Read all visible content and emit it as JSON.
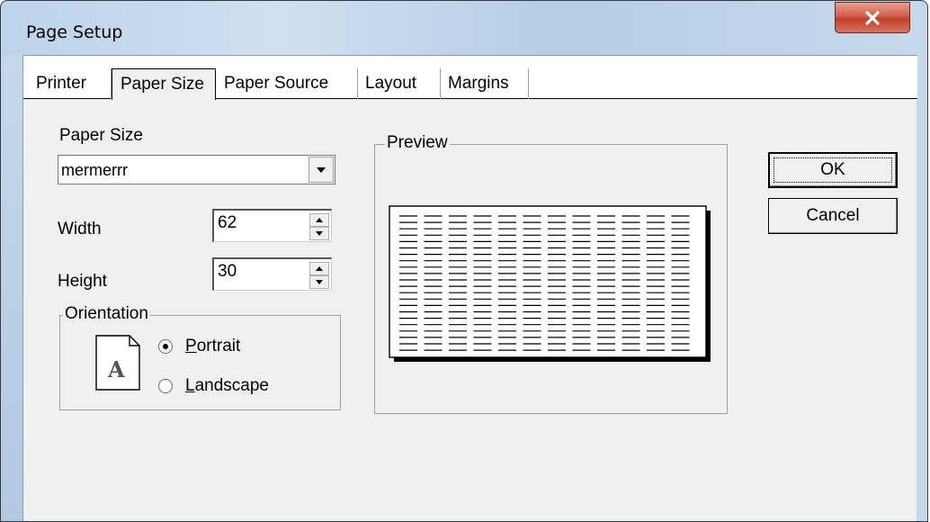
{
  "window": {
    "title": "Page Setup"
  },
  "tabs": [
    {
      "label": "Printer",
      "active": false
    },
    {
      "label": "Paper Size",
      "active": true
    },
    {
      "label": "Paper Source",
      "active": false
    },
    {
      "label": "Layout",
      "active": false
    },
    {
      "label": "Margins",
      "active": false
    }
  ],
  "paper": {
    "size_label": "Paper Size",
    "size_value": "mermerrr",
    "width_label": "Width",
    "width_value": "62",
    "height_label": "Height",
    "height_value": "30"
  },
  "orientation": {
    "group_label": "Orientation",
    "icon_letter": "A",
    "portrait_rest": "ortrait",
    "portrait_accel": "P",
    "landscape_rest": "andscape",
    "landscape_accel": "L",
    "selected": "portrait"
  },
  "preview": {
    "group_label": "Preview"
  },
  "buttons": {
    "ok": "OK",
    "cancel": "Cancel"
  },
  "icons": [
    "close-icon",
    "dropdown-arrow-icon",
    "spin-up-icon",
    "spin-down-icon",
    "page-icon"
  ]
}
